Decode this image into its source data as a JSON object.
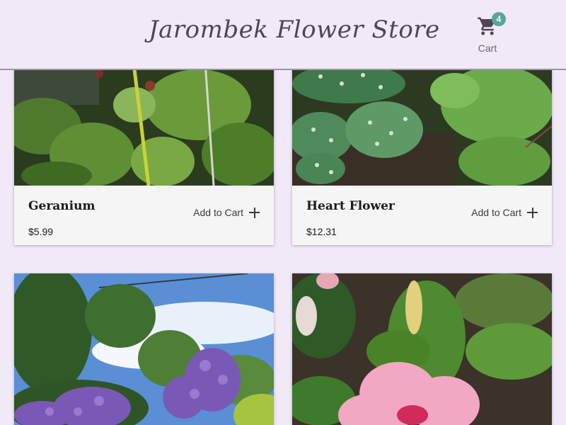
{
  "header": {
    "title": "Jarombek Flower Store",
    "cart": {
      "label": "Cart",
      "count": "4",
      "icon": "shopping-cart-icon",
      "badge_color": "#5aa697"
    }
  },
  "products": [
    {
      "name": "Geranium",
      "price": "$5.99",
      "add_label": "Add to Cart"
    },
    {
      "name": "Heart Flower",
      "price": "$12.31",
      "add_label": "Add to Cart"
    },
    {
      "name": "",
      "price": "",
      "add_label": ""
    },
    {
      "name": "",
      "price": "",
      "add_label": ""
    }
  ],
  "colors": {
    "background": "#f1e9f8",
    "card": "#f5f5f5",
    "title": "#4f4557"
  }
}
